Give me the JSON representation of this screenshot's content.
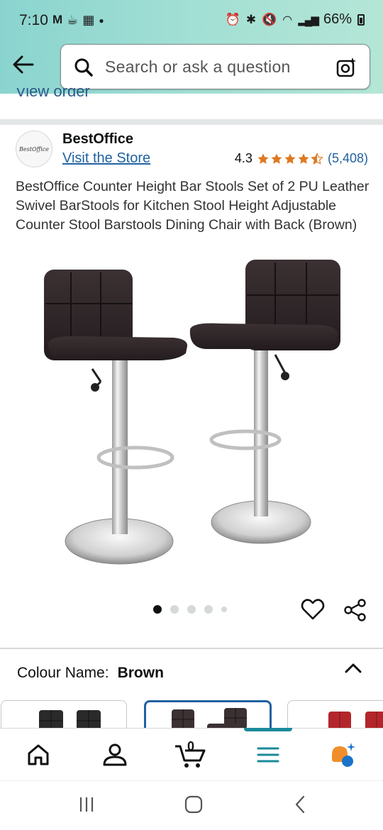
{
  "status_bar": {
    "time": "7:10",
    "battery": "66%",
    "left_icons": [
      "gmail-icon",
      "cup-icon",
      "calendar-icon",
      "dot-icon"
    ],
    "right_icons": [
      "alarm-icon",
      "bluetooth-icon",
      "mute-icon",
      "wifi-icon",
      "signal-icon",
      "battery-icon"
    ]
  },
  "header": {
    "search_placeholder": "Search or ask a question"
  },
  "partial_link": "View order",
  "brand": {
    "logo_text": "BestOffice",
    "name": "BestOffice",
    "visit_store": "Visit the Store",
    "rating": "4.3",
    "stars": 4.3,
    "rating_count": "(5,408)"
  },
  "product": {
    "title": "BestOffice Counter Height Bar Stools Set of 2 PU Leather Swivel BarStools for Kitchen Stool Height Adjustable Counter Stool Barstools Dining Chair with Back (Brown)",
    "image_count": 5,
    "image_index": 1
  },
  "variant": {
    "label": "Colour Name:",
    "value": "Brown"
  },
  "colors": {
    "accent": "#2162a1",
    "teal": "#1b8a9a",
    "star": "#de7921",
    "header_bg": "#a2dfd4"
  },
  "bottom_nav": [
    "home-icon",
    "account-icon",
    "cart-icon",
    "menu-icon",
    "rufus-icon"
  ],
  "cart_count": "0"
}
